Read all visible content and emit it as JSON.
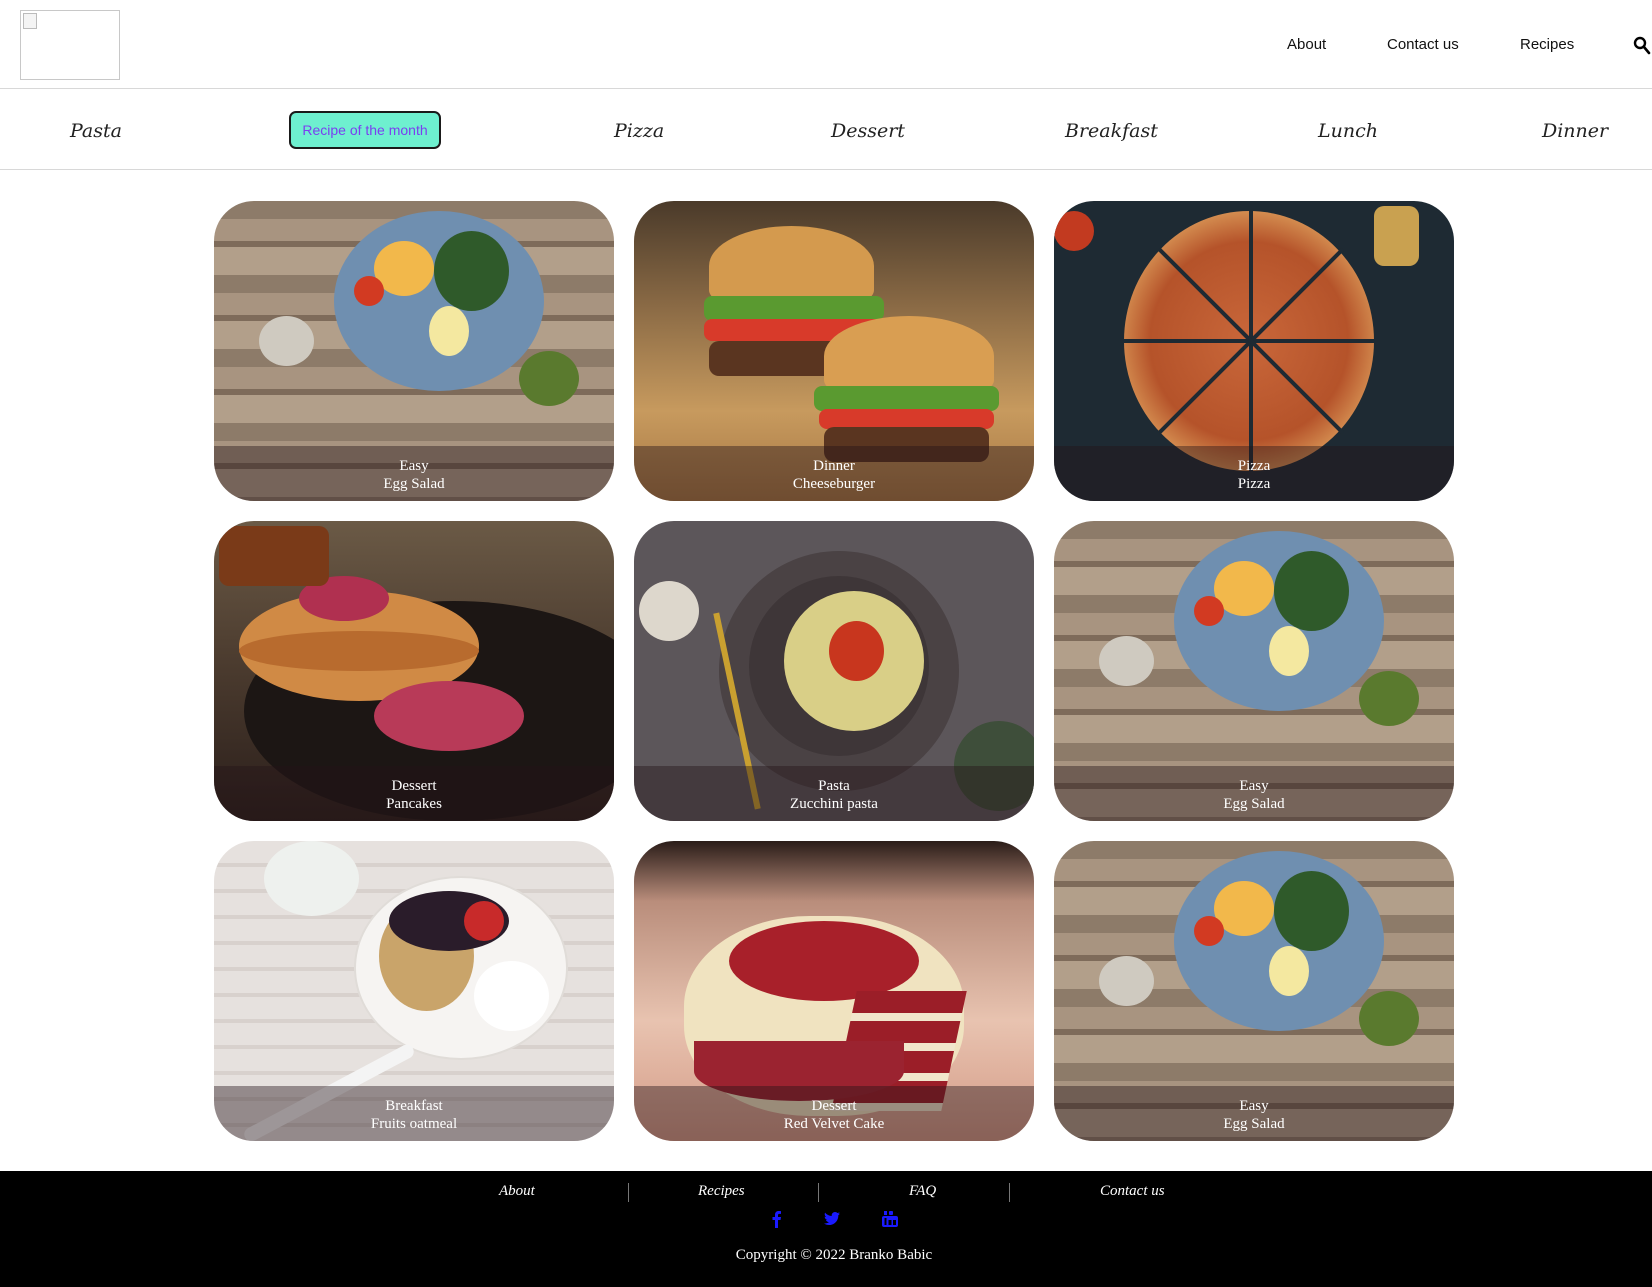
{
  "header": {
    "nav": [
      "About",
      "Contact us",
      "Recipes"
    ]
  },
  "categories": {
    "left": "Pasta",
    "recipe_of_month": "Recipe of the month",
    "right": [
      "Pizza",
      "Dessert",
      "Breakfast",
      "Lunch",
      "Dinner"
    ]
  },
  "cards": [
    {
      "category": "Easy",
      "name": "Egg Salad"
    },
    {
      "category": "Dinner",
      "name": "Cheeseburger"
    },
    {
      "category": "Pizza",
      "name": "Pizza"
    },
    {
      "category": "Dessert",
      "name": "Pancakes"
    },
    {
      "category": "Pasta",
      "name": "Zucchini pasta"
    },
    {
      "category": "Easy",
      "name": "Egg Salad"
    },
    {
      "category": "Breakfast",
      "name": "Fruits oatmeal"
    },
    {
      "category": "Dessert",
      "name": "Red Velvet Cake"
    },
    {
      "category": "Easy",
      "name": "Egg Salad"
    }
  ],
  "footer": {
    "links": [
      "About",
      "Recipes",
      "FAQ",
      "Contact us"
    ],
    "social_icons": [
      "facebook-icon",
      "twitter-icon",
      "youtube-icon"
    ],
    "social_color": "#1a1aff",
    "copyright": "Copyright © 2022 Branko Babic"
  },
  "colors": {
    "recipe_of_month_bg": "#6ef0cf",
    "recipe_of_month_text": "#7a3ff0"
  }
}
